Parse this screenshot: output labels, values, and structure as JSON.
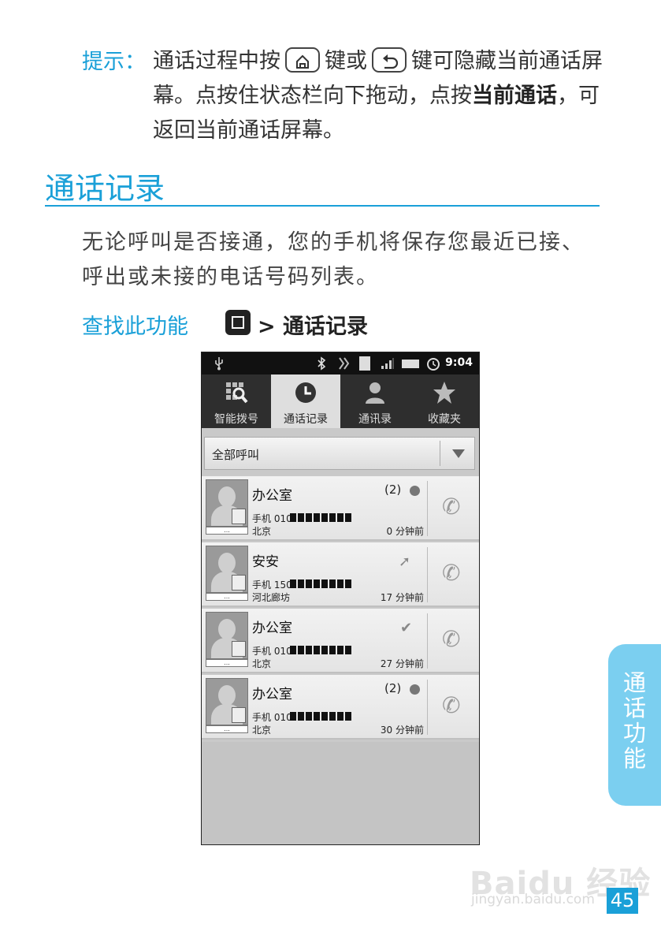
{
  "tip": {
    "label": "提示：",
    "text_1": "通话过程中按",
    "text_2": "键或",
    "text_3": "键可隐藏当前通话屏幕。点按住状态栏向下拖动，点按",
    "bold": "当前通话",
    "text_4": "，可返回当前通话屏幕。"
  },
  "section": {
    "title": "通话记录",
    "intro": "无论呼叫是否接通，您的手机将保存您最近已接、呼出或未接的电话号码列表。",
    "find_label": "查找此功能",
    "path": "> 通话记录"
  },
  "phone": {
    "status_time": "9:04",
    "tabs": [
      {
        "label": "智能拨号",
        "icon": "dialpad-search-icon"
      },
      {
        "label": "通话记录",
        "icon": "clock-icon"
      },
      {
        "label": "通讯录",
        "icon": "person-icon"
      },
      {
        "label": "收藏夹",
        "icon": "star-icon"
      }
    ],
    "active_tab": 1,
    "filter": "全部呼叫",
    "avatar_bar": "...",
    "rows": [
      {
        "name": "办公室",
        "count": "(2)",
        "number": "手机 010",
        "location": "北京",
        "time": "0 分钟前",
        "type": "missed-expand"
      },
      {
        "name": "安安",
        "count": "",
        "number": "手机 150",
        "location": "河北廊坊",
        "time": "17 分钟前",
        "type": "outgoing"
      },
      {
        "name": "办公室",
        "count": "",
        "number": "手机 010",
        "location": "北京",
        "time": "27 分钟前",
        "type": "missed"
      },
      {
        "name": "办公室",
        "count": "(2)",
        "number": "手机 010",
        "location": "北京",
        "time": "30 分钟前",
        "type": "missed-expand"
      }
    ]
  },
  "side_tab": "通话功能",
  "watermark": {
    "brand": "Baidu 经验",
    "url": "jingyan.baidu.com"
  },
  "page_number": "45"
}
